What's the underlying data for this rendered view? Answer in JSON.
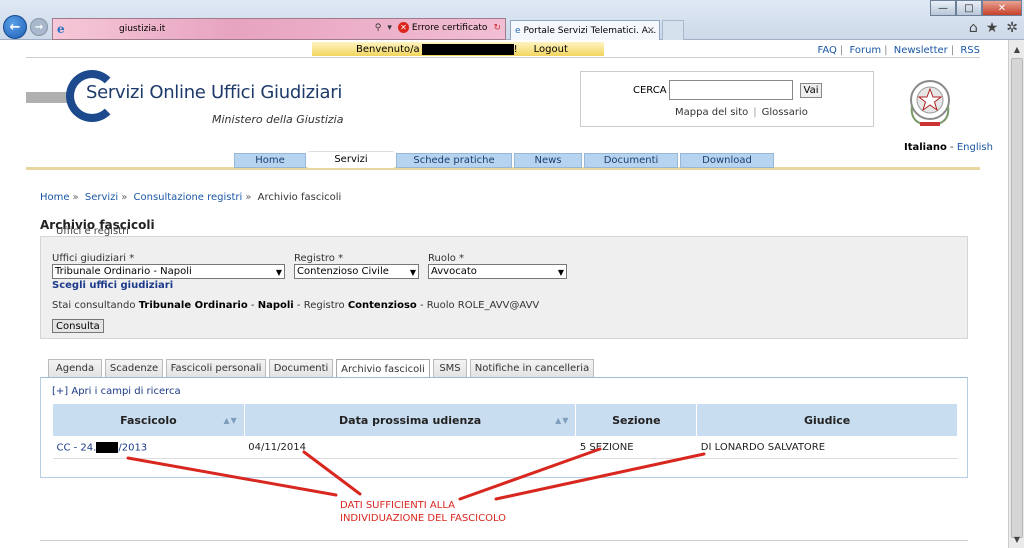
{
  "browser": {
    "url": "giustizia.it",
    "cert_error": "Errore certificato",
    "tab_title": "Portale Servizi Telematici. A...",
    "tab_close": "×",
    "win_min": "—",
    "win_max": "□",
    "win_close": "✕",
    "icon_home": "⌂",
    "icon_star": "★",
    "icon_gear": "✲"
  },
  "topbar": {
    "welcome_label": "Benvenuto/a",
    "welcome_suffix": "!",
    "logout": "Logout",
    "links": [
      "FAQ",
      "Forum",
      "Newsletter",
      "RSS"
    ]
  },
  "header": {
    "logo_title": "Servizi Online Uffici Giudiziari",
    "logo_subtitle": "Ministero della Giustizia",
    "search_label": "CERCA",
    "search_value": "",
    "search_button": "Vai",
    "links": [
      "Mappa del sito",
      "Glossario"
    ],
    "lang_it": "Italiano",
    "lang_sep": "-",
    "lang_en": "English"
  },
  "menu": [
    {
      "label": "Home",
      "active": false
    },
    {
      "label": "Servizi",
      "active": true
    },
    {
      "label": "Schede pratiche",
      "active": false
    },
    {
      "label": "News",
      "active": false
    },
    {
      "label": "Documenti",
      "active": false
    },
    {
      "label": "Download",
      "active": false
    }
  ],
  "breadcrumb": [
    "Home",
    "Servizi",
    "Consultazione registri",
    "Archivio fascicoli"
  ],
  "page": {
    "title": "Archivio fascicoli",
    "ghost_title": "Uffici e registri"
  },
  "filter": {
    "uffici_label": "Uffici giudiziari *",
    "uffici_value": "Tribunale Ordinario - Napoli",
    "registro_label": "Registro *",
    "registro_value": "Contenzioso Civile",
    "ruolo_label": "Ruolo *",
    "ruolo_value": "Avvocato",
    "choose_link": "Scegli uffici giudiziari",
    "info_prefix": "Stai consultando",
    "info_office": "Tribunale Ordinario",
    "info_sep": "-",
    "info_city": "Napoli",
    "info_registro_label": "- Registro",
    "info_registro": "Contenzioso",
    "info_ruolo": "- Ruolo ROLE_AVV@AVV",
    "button": "Consulta"
  },
  "tabs": [
    {
      "label": "Agenda",
      "active": false
    },
    {
      "label": "Scadenze",
      "active": false
    },
    {
      "label": "Fascicoli personali",
      "active": false
    },
    {
      "label": "Documenti",
      "active": false
    },
    {
      "label": "Archivio fascicoli",
      "active": true
    },
    {
      "label": "SMS",
      "active": false
    },
    {
      "label": "Notifiche in cancelleria",
      "active": false
    }
  ],
  "results": {
    "open_search": "[+] Apri i campi di ricerca",
    "columns": [
      "Fascicolo",
      "Data prossima udienza",
      "Sezione",
      "Giudice"
    ],
    "sort_glyph": "▲▼",
    "rows": [
      {
        "fascicolo_prefix": "CC - 24.",
        "fascicolo_suffix": "/2013",
        "data": "04/11/2014",
        "sezione": "5 SEZIONE",
        "giudice": "DI LONARDO SALVATORE"
      }
    ]
  },
  "annotation": {
    "line1": "DATI SUFFICIENTI ALLA",
    "line2": "INDIVIDUAZIONE DEL FASCICOLO",
    "color": "#d8271f"
  }
}
